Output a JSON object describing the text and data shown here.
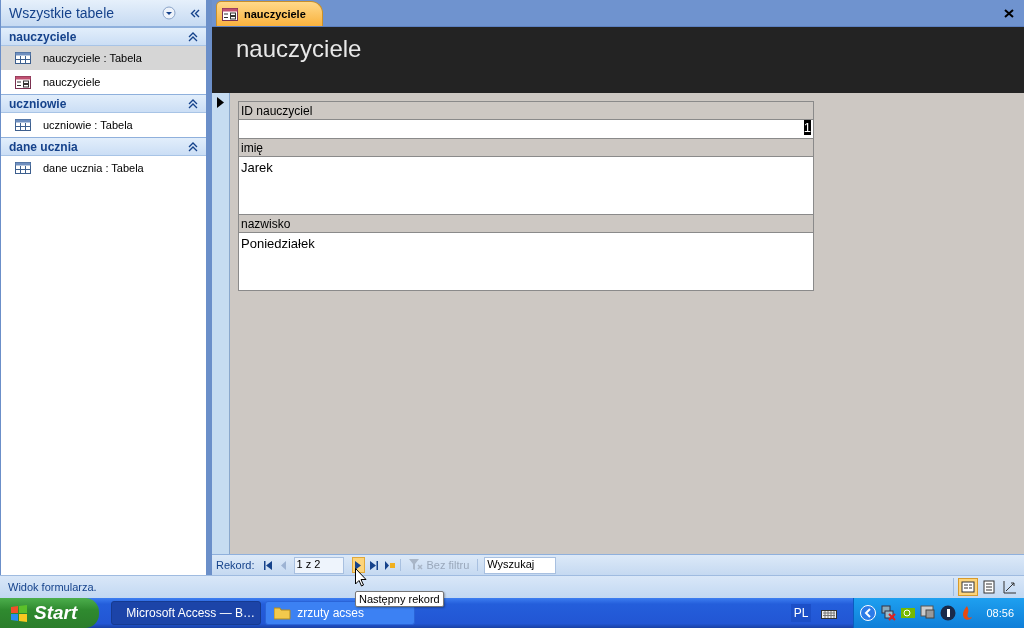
{
  "navigation_pane": {
    "title": "Wszystkie tabele",
    "groups": [
      {
        "name": "nauczyciele",
        "expanded": true,
        "items": [
          {
            "kind": "table",
            "label": "nauczyciele : Tabela",
            "selected": true
          },
          {
            "kind": "form",
            "label": "nauczyciele",
            "selected": false
          }
        ]
      },
      {
        "name": "uczniowie",
        "expanded": true,
        "items": [
          {
            "kind": "table",
            "label": "uczniowie : Tabela",
            "selected": false
          }
        ]
      },
      {
        "name": "dane ucznia",
        "expanded": true,
        "items": [
          {
            "kind": "table",
            "label": "dane ucznia : Tabela",
            "selected": false
          }
        ]
      }
    ]
  },
  "document_tab": {
    "label": "nauczyciele",
    "selected": true
  },
  "form": {
    "title": "nauczyciele",
    "fields": [
      {
        "label": "ID nauczyciel",
        "value": "1",
        "kind": "number"
      },
      {
        "label": "imię",
        "value": "Jarek",
        "kind": "text"
      },
      {
        "label": "nazwisko",
        "value": "Poniedziałek",
        "kind": "text"
      }
    ]
  },
  "record_navigator": {
    "label": "Rekord:",
    "position": "1 z 2",
    "filter": "Bez filtru",
    "search": "Wyszukaj"
  },
  "tooltip": "Następny rekord",
  "status_bar": {
    "text": "Widok formularza.",
    "views": [
      {
        "kind": "form",
        "selected": true
      },
      {
        "kind": "layout",
        "selected": false
      },
      {
        "kind": "design",
        "selected": false
      }
    ]
  },
  "taskbar": {
    "start": "Start",
    "buttons": [
      {
        "label": "Microsoft Access — B…",
        "kind": "access",
        "selected": true
      },
      {
        "label": "zrzuty acses",
        "kind": "folder",
        "selected": false
      }
    ],
    "language": "PL",
    "clock": "08:56"
  }
}
